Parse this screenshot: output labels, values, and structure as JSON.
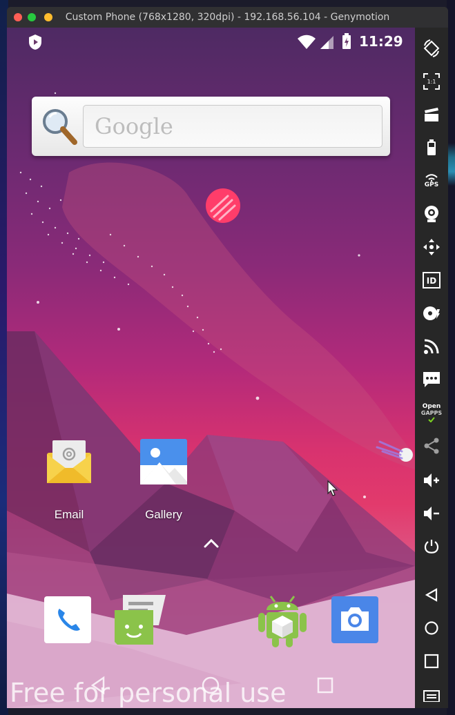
{
  "window": {
    "title": "Custom Phone (768x1280, 320dpi) - 192.168.56.104 - Genymotion"
  },
  "statusbar": {
    "time": "11:29",
    "icons": [
      "shield-icon",
      "wifi-icon",
      "signal-icon",
      "battery-charging-icon"
    ]
  },
  "search_widget": {
    "hint": "Google"
  },
  "apps": [
    {
      "label": "Email",
      "icon": "email-icon"
    },
    {
      "label": "Gallery",
      "icon": "gallery-icon"
    }
  ],
  "dock": [
    {
      "icon": "phone-icon"
    },
    {
      "icon": "messaging-icon"
    },
    {
      "icon": "android-app-icon"
    },
    {
      "icon": "camera-icon"
    }
  ],
  "navbar": {
    "icons": [
      "back-icon",
      "home-icon",
      "recent-apps-icon"
    ]
  },
  "watermark": "Free for personal use",
  "sidebar": {
    "gps_label": "GPS",
    "id_label": "ID",
    "opengapps_label_1": "Open",
    "opengapps_label_2": "GAPPS",
    "scale_label": "1:1",
    "items": [
      "rotate-icon",
      "scale-icon",
      "screencast-icon",
      "battery-icon",
      "gps-icon",
      "webcam-icon",
      "move-icon",
      "identifiers-icon",
      "disk-icon",
      "remote-control-icon",
      "sms-icon",
      "opengapps-icon",
      "share-icon",
      "volume-up-icon",
      "volume-down-icon",
      "power-icon",
      "back-icon",
      "home-icon",
      "recent-apps-icon",
      "menu-icon"
    ]
  }
}
